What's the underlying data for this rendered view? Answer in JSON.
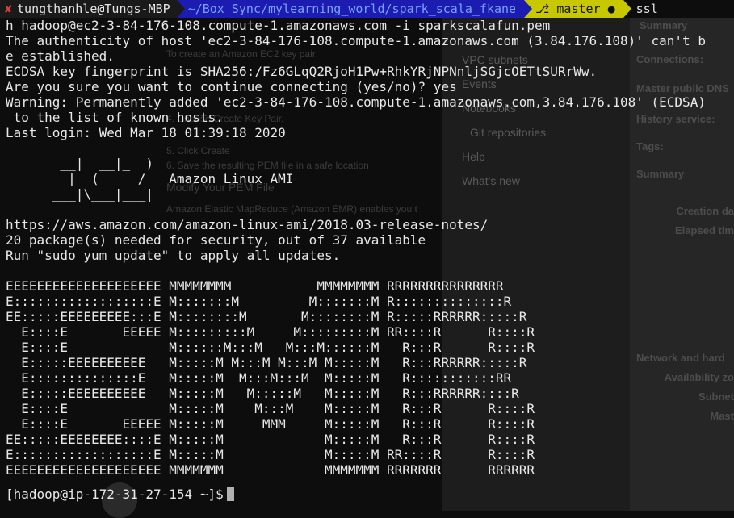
{
  "prompt": {
    "user": "tungthanhle@Tungs-MBP",
    "path": "~/Box Sync/mylearning_world/spark_scala_fkane",
    "branch_label": "master",
    "tail": "ssl"
  },
  "terminal_lines": [
    "h hadoop@ec2-3-84-176-108.compute-1.amazonaws.com -i sparkscalafun.pem",
    "The authenticity of host 'ec2-3-84-176-108.compute-1.amazonaws.com (3.84.176.108)' can't b",
    "e established.",
    "ECDSA key fingerprint is SHA256:/Fz6GLqQ2RjoH1Pw+RhkYRjNPNnljSGjcOETtSURrWw.",
    "Are you sure you want to continue connecting (yes/no)? yes",
    "Warning: Permanently added 'ec2-3-84-176-108.compute-1.amazonaws.com,3.84.176.108' (ECDSA)",
    " to the list of known hosts.",
    "Last login: Wed Mar 18 01:39:18 2020",
    "",
    "       __|  __|_  )",
    "       _|  (     /   Amazon Linux AMI",
    "      ___|\\___|___|",
    "",
    "https://aws.amazon.com/amazon-linux-ami/2018.03-release-notes/",
    "20 package(s) needed for security, out of 37 available",
    "Run \"sudo yum update\" to apply all updates.",
    "",
    "EEEEEEEEEEEEEEEEEEEE MMMMMMMM           MMMMMMMM RRRRRRRRRRRRRRR",
    "E::::::::::::::::::E M:::::::M         M:::::::M R::::::::::::::R",
    "EE:::::EEEEEEEEE:::E M::::::::M       M::::::::M R:::::RRRRRR:::::R",
    "  E::::E       EEEEE M:::::::::M     M:::::::::M RR::::R      R::::R",
    "  E::::E             M::::::M:::M   M:::M::::::M   R:::R      R::::R",
    "  E:::::EEEEEEEEEE   M:::::M M:::M M:::M M:::::M   R:::RRRRRR:::::R",
    "  E::::::::::::::E   M:::::M  M:::M:::M  M:::::M   R:::::::::::RR",
    "  E:::::EEEEEEEEEE   M:::::M   M:::::M   M:::::M   R:::RRRRRR::::R",
    "  E::::E             M:::::M    M:::M    M:::::M   R:::R      R::::R",
    "  E::::E       EEEEE M:::::M     MMM     M:::::M   R:::R      R::::R",
    "EE:::::EEEEEEEE::::E M:::::M             M:::::M   R:::R      R::::R",
    "E::::::::::::::::::E M:::::M             M:::::M RR::::R      R::::R",
    "EEEEEEEEEEEEEEEEEEEE MMMMMMM             MMMMMMM RRRRRRR      RRRRRR"
  ],
  "shell_prompt": "[hadoop@ip-172-31-27-154 ~]$",
  "background": {
    "doc_lines": [
      "To create an Amazon EC2 key pair:",
      "4. Choose Create Key Pair.",
      "5. Click Create",
      "6. Save the resulting PEM file in a safe location",
      "Modify Your PEM File",
      "Amazon Elastic MapReduce (Amazon EMR) enables you t"
    ],
    "nav_items": [
      "VPC subnets",
      "Events",
      "Notebooks",
      "Git repositories",
      "Help",
      "What's new"
    ],
    "side_items": [
      "Summary",
      "Connections:",
      "Master public DNS",
      "History service:",
      "Tags:",
      "Summary",
      "Creation da",
      "Elapsed tim",
      "Network and hard",
      "Availability zo",
      "Subnet",
      "Mast"
    ]
  }
}
